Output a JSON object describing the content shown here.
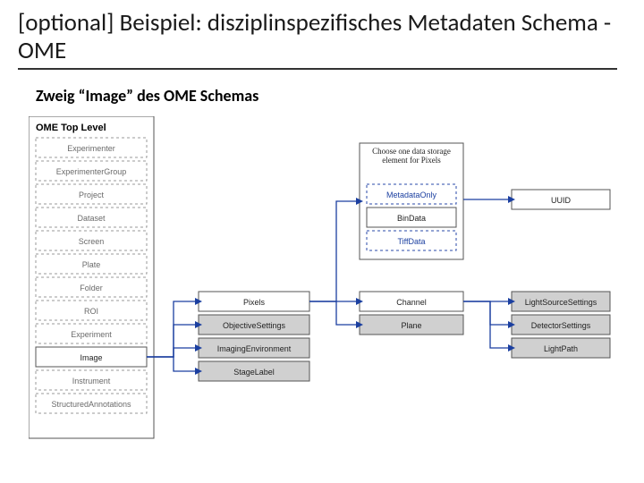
{
  "title": "[optional] Beispiel: disziplinspezifisches Metadaten Schema - OME",
  "subtitle": "Zweig “Image” des OME Schemas",
  "col1": {
    "header": "OME Top Level",
    "items": [
      "Experimenter",
      "ExperimenterGroup",
      "Project",
      "Dataset",
      "Screen",
      "Plate",
      "Folder",
      "ROI",
      "Experiment",
      "Image",
      "Instrument",
      "StructuredAnnotations"
    ]
  },
  "col2": [
    "Pixels",
    "ObjectiveSettings",
    "ImagingEnvironment",
    "StageLabel"
  ],
  "col3": {
    "hint": "Choose one data storage element for Pixels",
    "options": [
      "MetadataOnly",
      "BinData",
      "TiffData"
    ],
    "below": [
      "Channel",
      "Plane"
    ]
  },
  "col4": [
    "UUID",
    "LightSourceSettings",
    "DetectorSettings",
    "LightPath"
  ]
}
